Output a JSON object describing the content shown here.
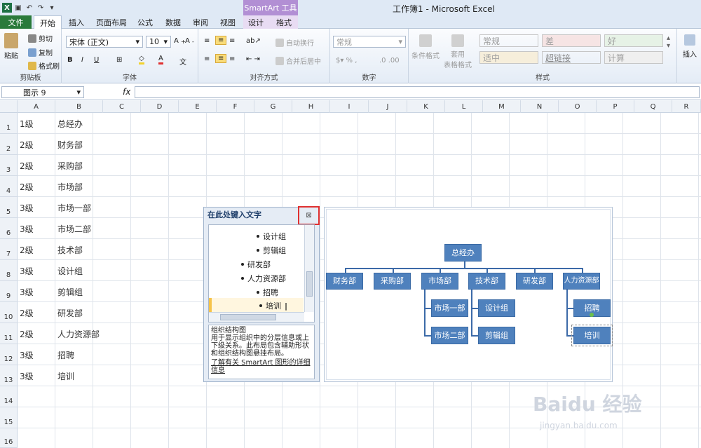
{
  "window": {
    "title": "工作簿1 - Microsoft Excel",
    "smartart_tools": "SmartArt 工具"
  },
  "tabs": [
    "文件",
    "开始",
    "插入",
    "页面布局",
    "公式",
    "数据",
    "审阅",
    "视图",
    "设计",
    "格式"
  ],
  "ribbon": {
    "clipboard": {
      "label": "剪贴板",
      "paste": "粘贴",
      "cut": "剪切",
      "copy": "复制",
      "format_painter": "格式刷"
    },
    "font": {
      "label": "字体",
      "font_name": "宋体 (正文)",
      "font_size": "10"
    },
    "alignment": {
      "label": "对齐方式",
      "wrap": "自动换行",
      "merge": "合并后居中"
    },
    "number": {
      "label": "数字",
      "format": "常规"
    },
    "styles": {
      "label": "样式",
      "conditional": "条件格式",
      "table_format": "套用\n表格格式",
      "cells": [
        "常规",
        "差",
        "好",
        "适中",
        "超链接",
        "计算"
      ]
    },
    "cells": {
      "insert": "插入"
    }
  },
  "formula_bar": {
    "name_box": "图示 9",
    "fx": "fx"
  },
  "columns": [
    "A",
    "B",
    "C",
    "D",
    "E",
    "F",
    "G",
    "H",
    "I",
    "J",
    "K",
    "L",
    "M",
    "N",
    "O",
    "P",
    "Q",
    "R"
  ],
  "rows": [
    {
      "n": "1",
      "a": "1级",
      "b": "总经办"
    },
    {
      "n": "2",
      "a": "2级",
      "b": "财务部"
    },
    {
      "n": "3",
      "a": "2级",
      "b": "采购部"
    },
    {
      "n": "4",
      "a": "2级",
      "b": "市场部"
    },
    {
      "n": "5",
      "a": "3级",
      "b": "市场一部"
    },
    {
      "n": "6",
      "a": "3级",
      "b": "市场二部"
    },
    {
      "n": "7",
      "a": "2级",
      "b": "技术部"
    },
    {
      "n": "8",
      "a": "3级",
      "b": "设计组"
    },
    {
      "n": "9",
      "a": "3级",
      "b": "剪辑组"
    },
    {
      "n": "10",
      "a": "2级",
      "b": "研发部"
    },
    {
      "n": "11",
      "a": "2级",
      "b": "人力资源部"
    },
    {
      "n": "12",
      "a": "3级",
      "b": "招聘"
    },
    {
      "n": "13",
      "a": "3级",
      "b": "培训"
    },
    {
      "n": "14",
      "a": "",
      "b": ""
    },
    {
      "n": "15",
      "a": "",
      "b": ""
    },
    {
      "n": "16",
      "a": "",
      "b": ""
    }
  ],
  "text_pane": {
    "title": "在此处键入文字",
    "items": [
      "设计组",
      "剪辑组",
      "研发部",
      "人力资源部",
      "招聘",
      "培训"
    ],
    "desc_title": "组织结构图",
    "desc_body": "用于显示组织中的分层信息或上下级关系。此布局包含辅助形状和组织结构图悬挂布局。",
    "desc_link": "了解有关 SmartArt 图形的详细信息"
  },
  "org_chart": {
    "root": "总经办",
    "level2": [
      "财务部",
      "采购部",
      "市场部",
      "技术部",
      "研发部",
      "人力资源部"
    ],
    "market_children": [
      "市场一部",
      "市场二部"
    ],
    "tech_children": [
      "设计组",
      "剪辑组"
    ],
    "hr_children": [
      "招聘",
      "培训"
    ]
  },
  "watermark": {
    "main": "Baidu 经验",
    "sub": "jingyan.baidu.com"
  }
}
